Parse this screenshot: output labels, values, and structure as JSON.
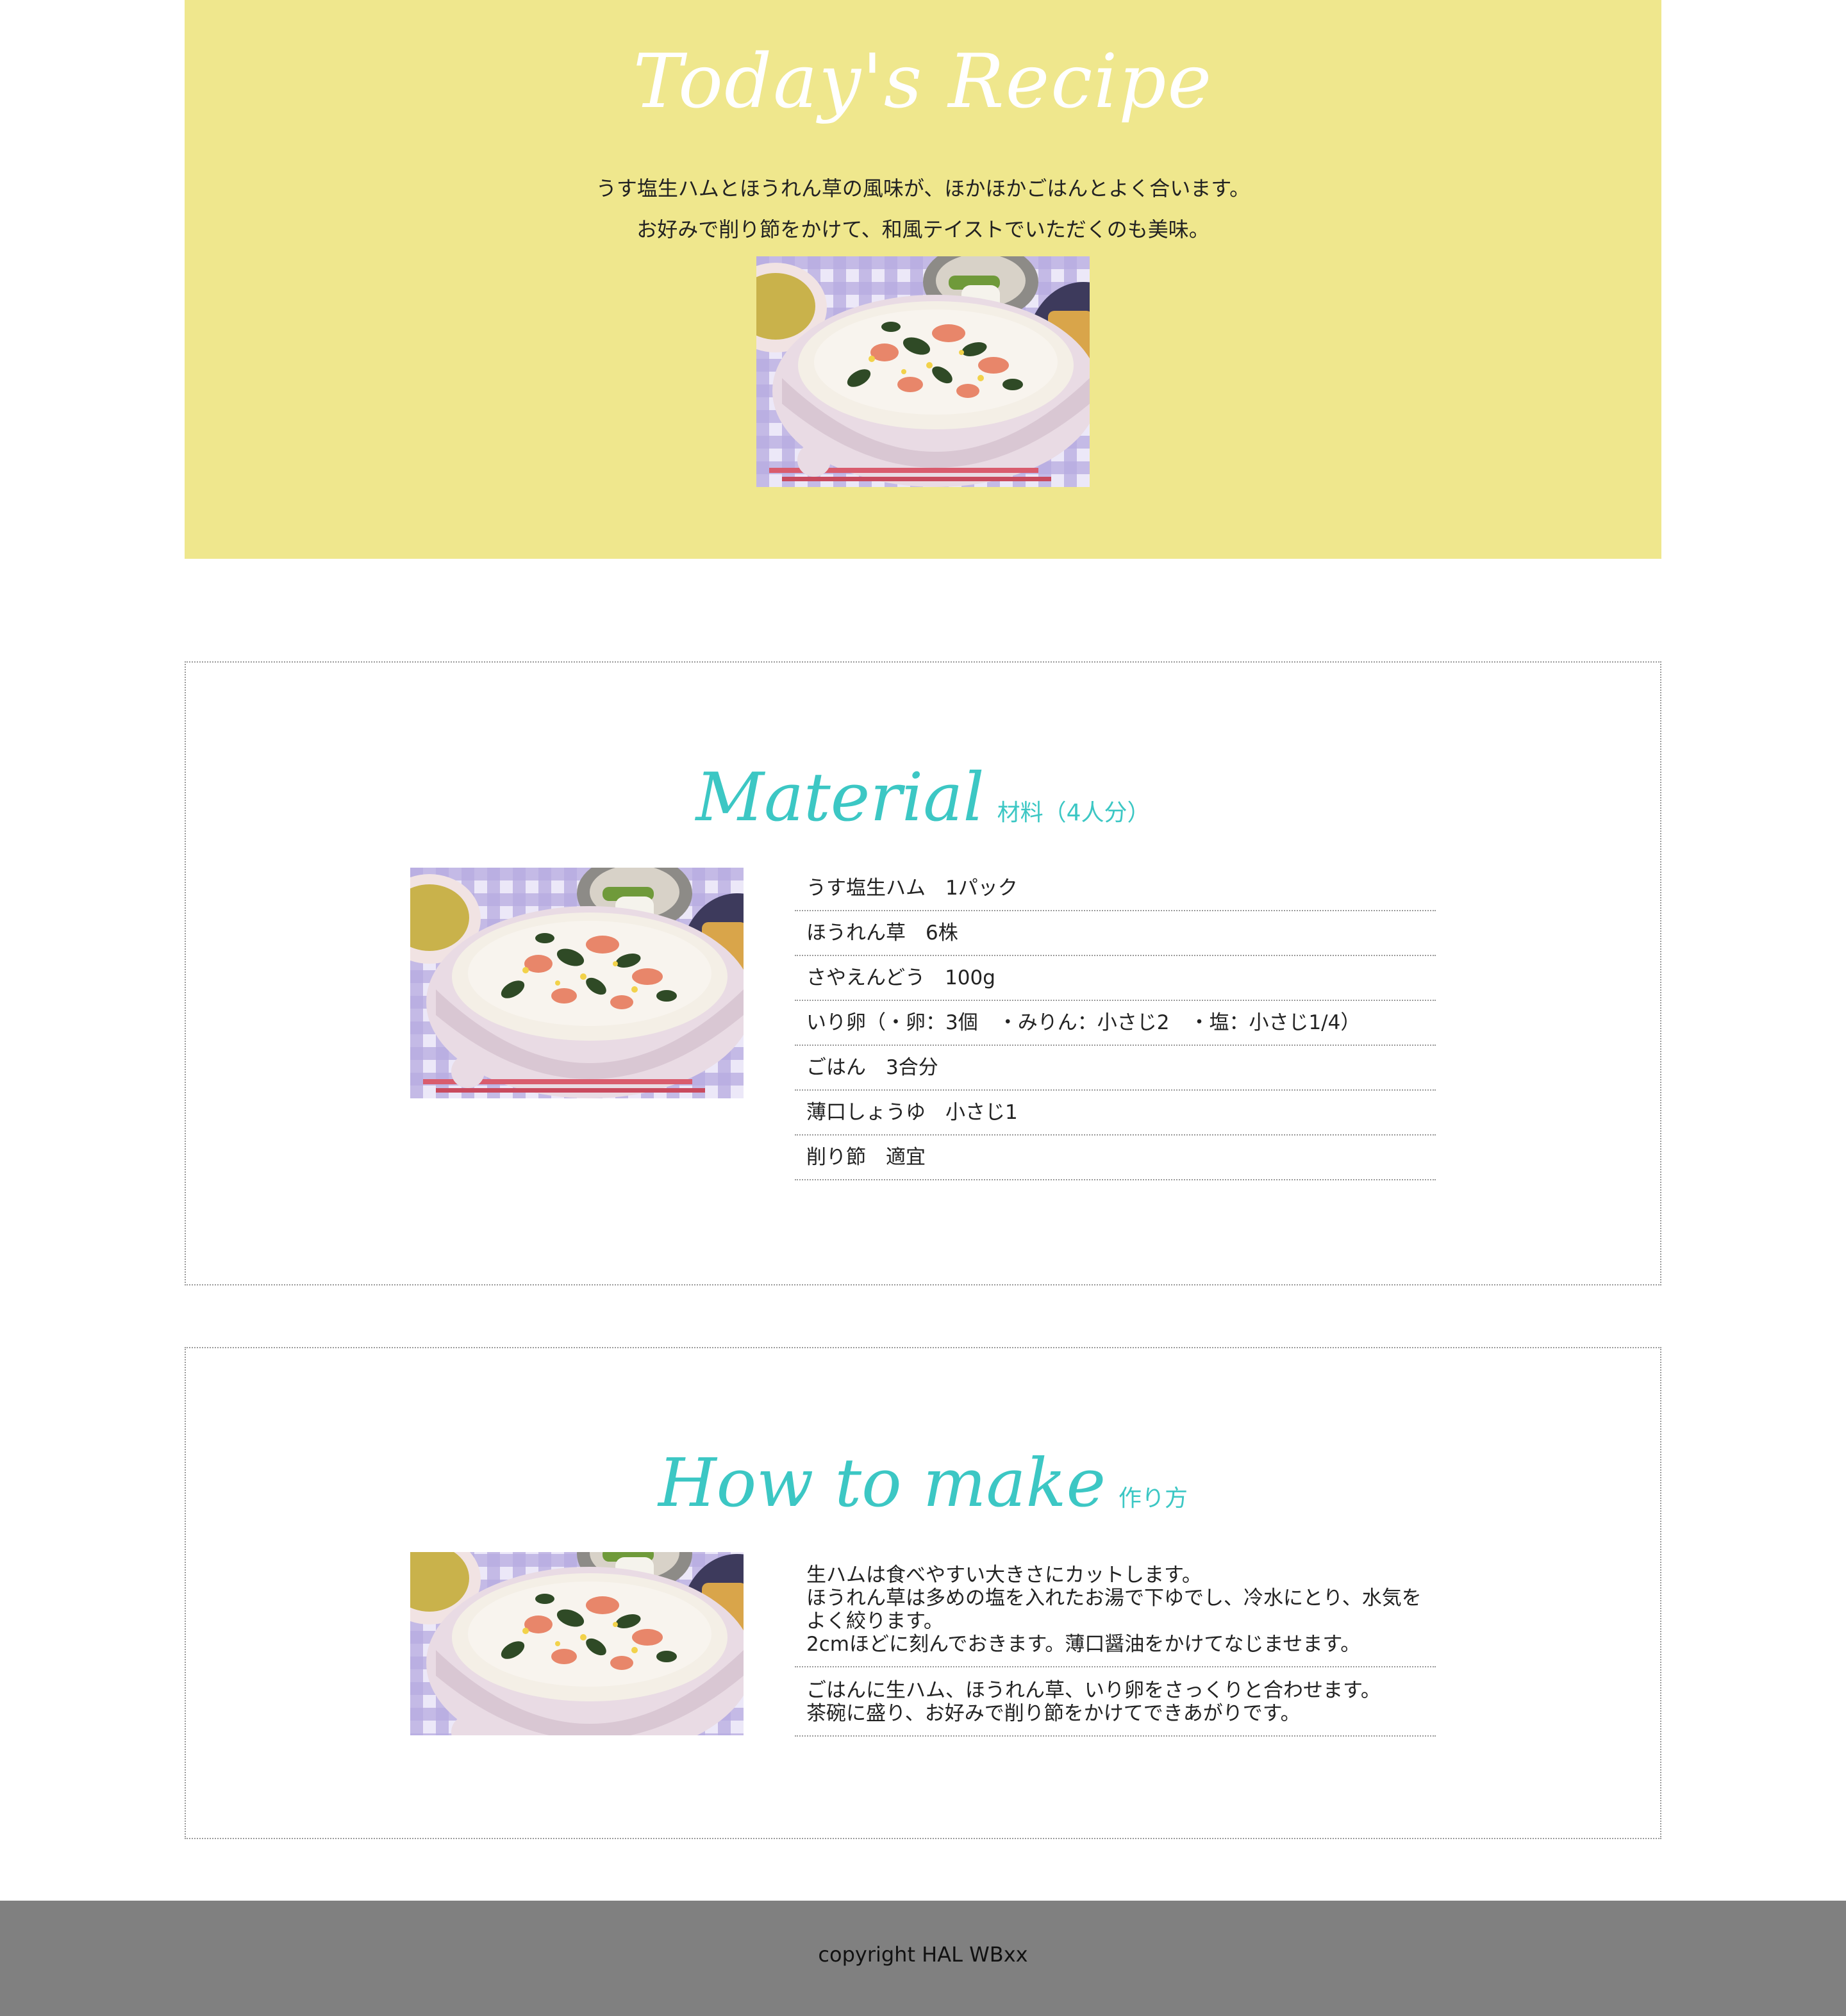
{
  "hero": {
    "title": "Today's Recipe",
    "lines": [
      "うす塩生ハムとほうれん草の風味が、ほかほかごはんとよく合います。",
      "お好みで削り節をかけて、和風テイストでいただくのも美味。"
    ]
  },
  "material": {
    "title_en": "Material",
    "title_ja": "材料（4人分）",
    "items": [
      "うす塩生ハム　1パック",
      "ほうれん草　6株",
      "さやえんどう　100g",
      "いり卵（・卵：3個　・みりん：小さじ2　・塩：小さじ1/4）",
      "ごはん　3合分",
      "薄口しょうゆ　小さじ1",
      "削り節　適宜"
    ]
  },
  "how": {
    "title_en": "How to make",
    "title_ja": "作り方",
    "steps": [
      [
        "生ハムは食べやすい大きさにカットします。",
        "ほうれん草は多めの塩を入れたお湯で下ゆでし、冷水にとり、水気をよく絞ります。",
        "2cmほどに刻んでおきます。薄口醤油をかけてなじませます。"
      ],
      [
        "ごはんに生ハム、ほうれん草、いり卵をさっくりと合わせます。",
        "茶碗に盛り、お好みで削り節をかけてできあがりです。"
      ]
    ]
  },
  "footer": {
    "text": "copyright HAL WBxx"
  },
  "colors": {
    "hero_bg": "#efe78d",
    "accent": "#3cc7c4",
    "footer_bg": "#808080"
  }
}
